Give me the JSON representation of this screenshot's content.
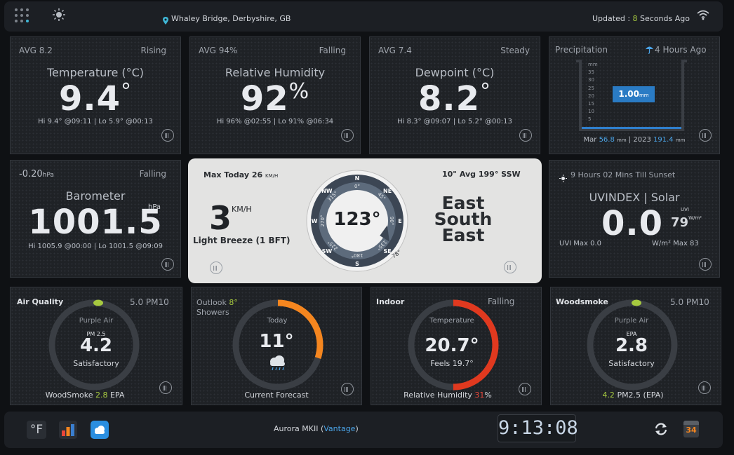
{
  "header": {
    "location": "Whaley Bridge, Derbyshire, GB",
    "updated_label": "Updated :",
    "updated_value": "8",
    "updated_suffix": "Seconds Ago"
  },
  "temperature": {
    "avg": "AVG 8.2",
    "trend": "Rising",
    "title": "Temperature (°C)",
    "value": "9.4",
    "unit": "°",
    "hilo": "Hi 9.4° @09:11 | Lo 5.9° @00:13"
  },
  "humidity": {
    "avg": "AVG 94%",
    "trend": "Falling",
    "title": "Relative Humidity",
    "value": "92",
    "unit": "%",
    "hilo": "Hi 96% @02:55 | Lo 91% @06:34"
  },
  "dewpoint": {
    "avg": "AVG 7.4",
    "trend": "Steady",
    "title": "Dewpoint (°C)",
    "value": "8.2",
    "unit": "°",
    "hilo": "Hi 8.3° @09:07 | Lo 5.2° @00:13"
  },
  "precip": {
    "title": "Precipitation",
    "ago": "4 Hours Ago",
    "value": "1.00",
    "unit": "mm",
    "scale": [
      "mm",
      "35",
      "30",
      "25",
      "20",
      "15",
      "10",
      "5"
    ],
    "fill_fraction": 0.03,
    "month": "Mar",
    "month_value": "56.8",
    "month_unit": "mm",
    "year": "2023",
    "year_value": "191.4",
    "year_unit": "mm"
  },
  "barometer": {
    "change": "-0.20",
    "change_unit": "hPa",
    "trend": "Falling",
    "title": "Barometer",
    "value": "1001.5",
    "unit": "hPa",
    "hilo": "Hi 1005.9 @00:00 | Lo 1001.5 @09:09"
  },
  "wind": {
    "max_label": "Max Today",
    "max_value": "26",
    "max_unit": "KM/H",
    "speed": "3",
    "speed_unit": "KM/H",
    "desc": "Light Breeze (1 BFT)",
    "avg_label": "10\" Avg 199° SSW",
    "direction": "123°",
    "dir_word1": "East",
    "dir_word2": "South",
    "dir_word3": "East",
    "cardinals": [
      "N",
      "NE",
      "E",
      "SE",
      "S",
      "SW",
      "W",
      "NW"
    ],
    "degrees": [
      "0°",
      "45°",
      "90°",
      "135°",
      "180°",
      "225°",
      "270°",
      "315°"
    ],
    "pointer": "78°"
  },
  "uv": {
    "sunset": "9 Hours 02 Mins Till Sunset",
    "title": "UVINDEX | Solar",
    "value": "0.0",
    "uvi_label": "UVI",
    "solar": "79",
    "solar_unit": "W/m²",
    "uvi_max": "UVI Max 0.0",
    "solar_max": "W/m² Max 83"
  },
  "air": {
    "title": "Air Quality",
    "pm10": "5.0 PM10",
    "source": "Purple Air",
    "pm_label": "PM 2.5",
    "value": "4.2",
    "status": "Satisfactory",
    "foot_label": "WoodSmoke",
    "foot_value": "2.8",
    "foot_unit": "EPA"
  },
  "outlook": {
    "title": "Outlook",
    "temp": "8°",
    "cond": "Showers",
    "day": "Today",
    "value": "11°",
    "foot": "Current Forecast",
    "arc_fraction": 0.3
  },
  "indoor": {
    "title": "Indoor",
    "trend": "Falling",
    "label": "Temperature",
    "value": "20.7°",
    "feels": "Feels 19.7°",
    "foot_label": "Relative Humidity",
    "foot_value": "31",
    "foot_unit": "%",
    "arc_fraction": 0.5
  },
  "woodsmoke": {
    "title": "Woodsmoke",
    "pm10": "5.0 PM10",
    "source": "Purple Air",
    "label": "EPA",
    "value": "2.8",
    "status": "Satisfactory",
    "foot_value": "4.2",
    "foot_label": "PM2.5 (EPA)"
  },
  "footer": {
    "unit_btn": "°F",
    "station": "Aurora MKII",
    "station_sub": "Vantage",
    "time": "9:13:08",
    "calendar": "34"
  },
  "colors": {
    "green": "#a6c93f",
    "blue": "#4aa3e6",
    "orange": "#f5861f",
    "red": "#e0391f"
  }
}
